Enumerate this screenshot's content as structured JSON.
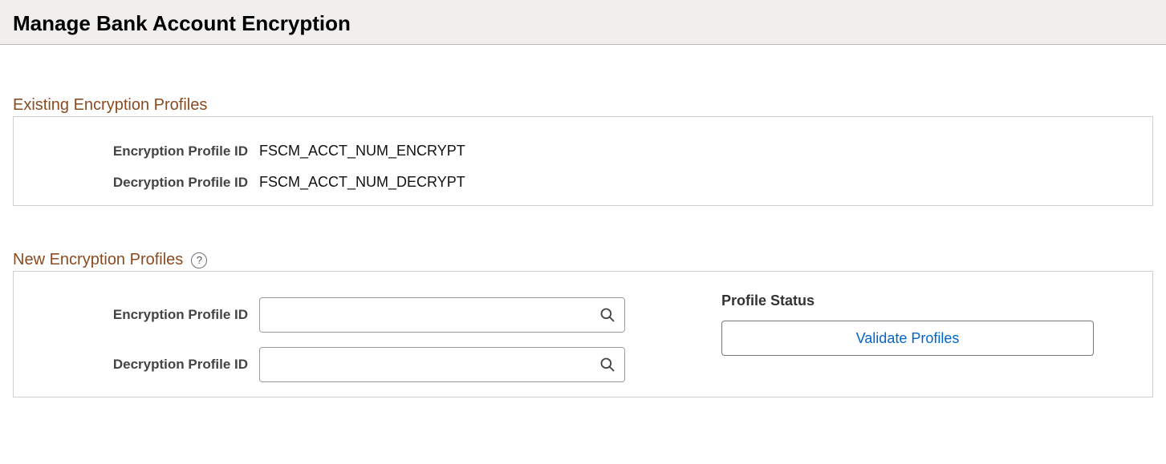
{
  "header": {
    "title": "Manage Bank Account Encryption"
  },
  "existing": {
    "section_title": "Existing Encryption Profiles",
    "encryption_label": "Encryption Profile ID",
    "encryption_value": "FSCM_ACCT_NUM_ENCRYPT",
    "decryption_label": "Decryption Profile ID",
    "decryption_value": "FSCM_ACCT_NUM_DECRYPT"
  },
  "new": {
    "section_title": "New Encryption Profiles",
    "help_glyph": "?",
    "encryption_label": "Encryption Profile ID",
    "encryption_value": "",
    "decryption_label": "Decryption Profile ID",
    "decryption_value": "",
    "status_heading": "Profile Status",
    "validate_button": "Validate Profiles"
  }
}
